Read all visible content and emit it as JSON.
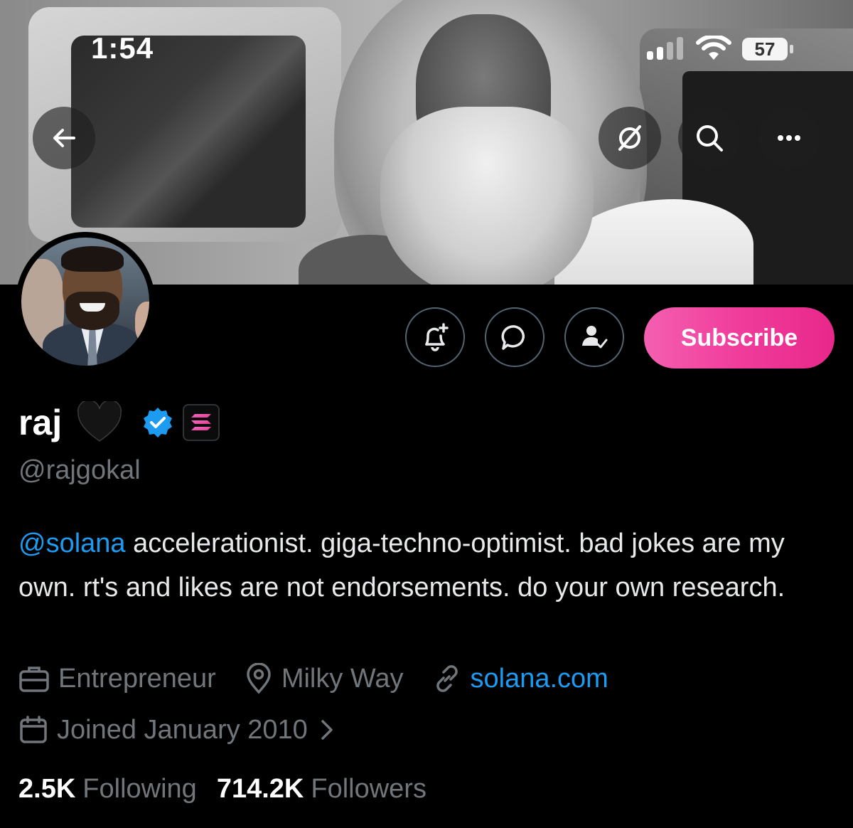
{
  "status_bar": {
    "time": "1:54",
    "battery": "57"
  },
  "banner_buttons": [
    "back-arrow",
    "grok-icon",
    "search-icon",
    "more-icon"
  ],
  "profile": {
    "name": "raj",
    "heart_emoji": "🖤",
    "handle": "@rajgokal",
    "bio_mention": "@solana",
    "bio_text": " accelerationist. giga-techno-optimist. bad jokes are my own. rt's and likes are not endorsements. do your own research.",
    "occupation": "Entrepreneur",
    "location": "Milky Way",
    "website": "solana.com",
    "joined": "Joined January 2010"
  },
  "actions": {
    "subscribe_label": "Subscribe"
  },
  "stats": {
    "following_count": "2.5K",
    "following_label": "Following",
    "followers_count": "714.2K",
    "followers_label": "Followers"
  },
  "colors": {
    "accent": "#1d9bf0",
    "subscribe": "#f03c9b",
    "muted": "#71767b"
  }
}
